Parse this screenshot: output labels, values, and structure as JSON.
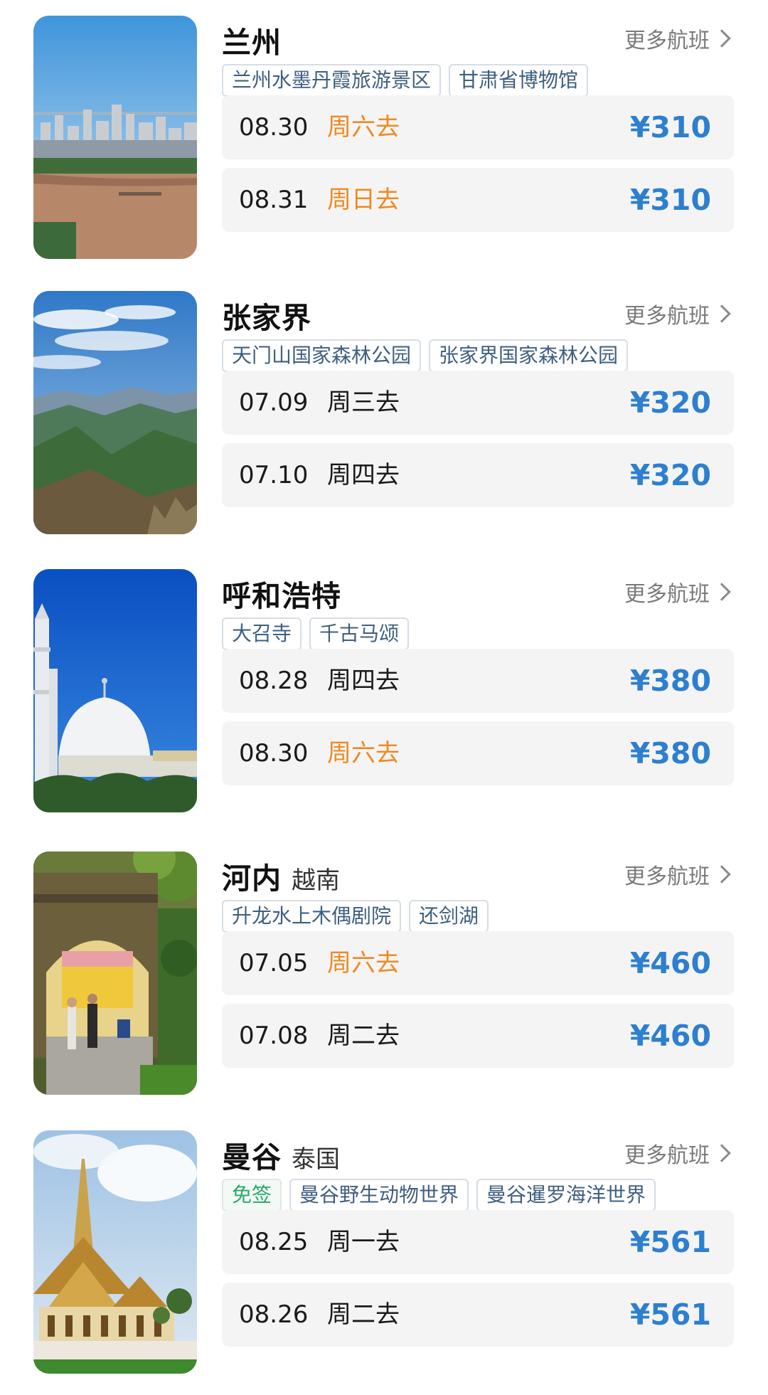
{
  "more_flights_label": "更多航班",
  "colors": {
    "price": "#2d7fcf",
    "weekend_day": "#ef8a1f",
    "visa_free": "#2aa868",
    "tag_text": "#3f5f80"
  },
  "destinations": [
    {
      "city": "兰州",
      "country": "",
      "photo": "lanzhou-city-river-photo",
      "tags": [
        "兰州水墨丹霞旅游景区",
        "甘肃省博物馆"
      ],
      "flights": [
        {
          "date": "08.30",
          "day": "周六去",
          "price": "¥310",
          "weekend": true
        },
        {
          "date": "08.31",
          "day": "周日去",
          "price": "¥310",
          "weekend": true
        }
      ]
    },
    {
      "city": "张家界",
      "country": "",
      "photo": "zhangjiajie-mountains-photo",
      "tags": [
        "天门山国家森林公园",
        "张家界国家森林公园"
      ],
      "flights": [
        {
          "date": "07.09",
          "day": "周三去",
          "price": "¥320",
          "weekend": false
        },
        {
          "date": "07.10",
          "day": "周四去",
          "price": "¥320",
          "weekend": false
        }
      ]
    },
    {
      "city": "呼和浩特",
      "country": "",
      "photo": "hohhot-mosque-photo",
      "tags": [
        "大召寺",
        "千古马颂"
      ],
      "flights": [
        {
          "date": "08.28",
          "day": "周四去",
          "price": "¥380",
          "weekend": false
        },
        {
          "date": "08.30",
          "day": "周六去",
          "price": "¥380",
          "weekend": true
        }
      ]
    },
    {
      "city": "河内",
      "country": "越南",
      "photo": "hanoi-gate-photo",
      "tags": [
        "升龙水上木偶剧院",
        "还剑湖"
      ],
      "flights": [
        {
          "date": "07.05",
          "day": "周六去",
          "price": "¥460",
          "weekend": true
        },
        {
          "date": "07.08",
          "day": "周二去",
          "price": "¥460",
          "weekend": false
        }
      ]
    },
    {
      "city": "曼谷",
      "country": "泰国",
      "photo": "bangkok-palace-photo",
      "visa_badge": "免签",
      "tags": [
        "曼谷野生动物世界",
        "曼谷暹罗海洋世界"
      ],
      "flights": [
        {
          "date": "08.25",
          "day": "周一去",
          "price": "¥561",
          "weekend": false
        },
        {
          "date": "08.26",
          "day": "周二去",
          "price": "¥561",
          "weekend": false
        }
      ]
    }
  ]
}
